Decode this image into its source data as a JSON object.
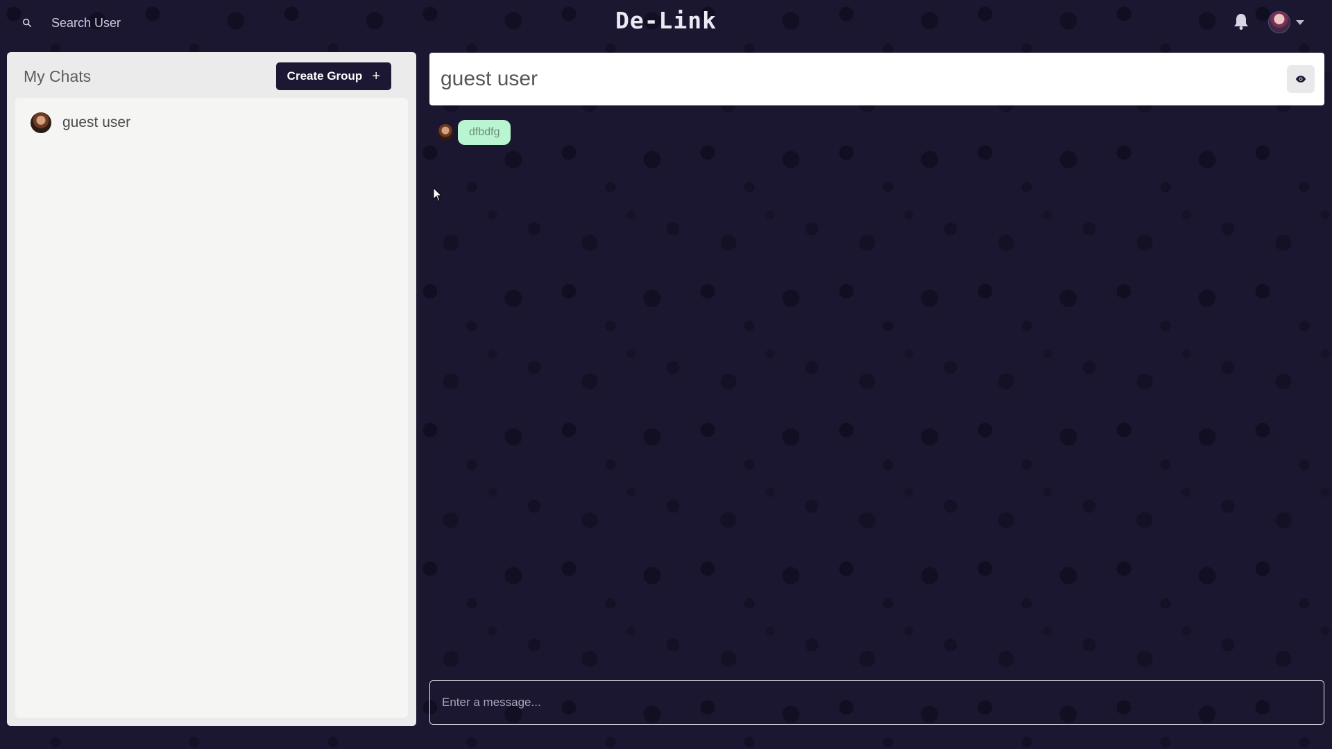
{
  "header": {
    "search_label": "Search User",
    "app_title": "De-Link"
  },
  "sidebar": {
    "title": "My Chats",
    "create_group_label": "Create Group",
    "create_group_icon": "+",
    "chats": [
      {
        "name": "guest user"
      }
    ]
  },
  "chat": {
    "title": "guest user",
    "messages": [
      {
        "text": "dfbdfg"
      }
    ],
    "input_placeholder": "Enter a message..."
  },
  "colors": {
    "background": "#1b1731",
    "accent_dark": "#1c1833",
    "bubble": "#b9f5d0"
  }
}
